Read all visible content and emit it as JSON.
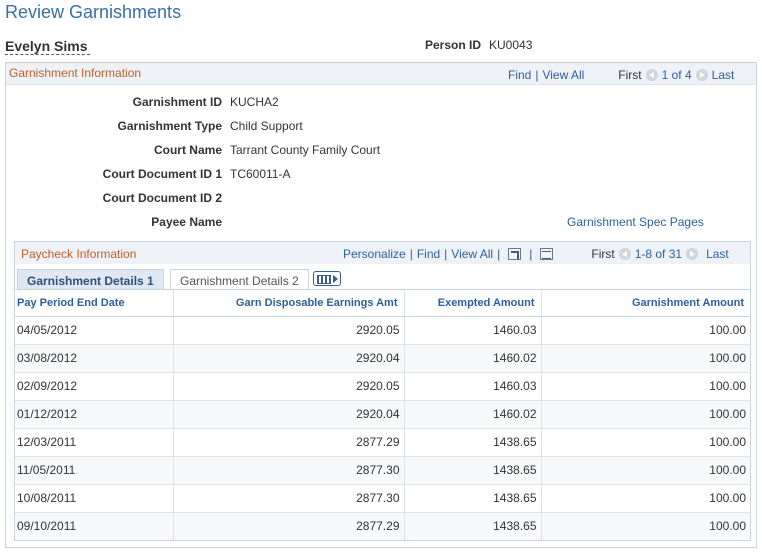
{
  "page": {
    "title": "Review Garnishments"
  },
  "person": {
    "name": "Evelyn Sims",
    "id_label": "Person ID",
    "id_value": "KU0043"
  },
  "garnishment_info": {
    "title": "Garnishment Information",
    "nav": {
      "find": "Find",
      "view_all": "View All",
      "first": "First",
      "count": "1 of 4",
      "last": "Last"
    },
    "fields": [
      {
        "label": "Garnishment ID",
        "value": "KUCHA2"
      },
      {
        "label": "Garnishment Type",
        "value": "Child Support"
      },
      {
        "label": "Court Name",
        "value": "Tarrant County Family Court"
      },
      {
        "label": "Court Document ID 1",
        "value": "TC60011-A"
      },
      {
        "label": "Court Document ID 2",
        "value": ""
      },
      {
        "label": "Payee Name",
        "value": ""
      }
    ],
    "spec_link": "Garnishment Spec Pages"
  },
  "paycheck_info": {
    "title": "Paycheck Information",
    "nav": {
      "personalize": "Personalize",
      "find": "Find",
      "view_all": "View All",
      "first": "First",
      "count": "1-8 of 31",
      "last": "Last"
    },
    "tabs": [
      {
        "label": "Garnishment Details 1",
        "active": true
      },
      {
        "label": "Garnishment Details 2",
        "active": false
      }
    ],
    "columns": [
      "Pay Period End Date",
      "Garn Disposable Earnings Amt",
      "Exempted Amount",
      "Garnishment Amount"
    ],
    "rows": [
      [
        "04/05/2012",
        "2920.05",
        "1460.03",
        "100.00"
      ],
      [
        "03/08/2012",
        "2920.04",
        "1460.02",
        "100.00"
      ],
      [
        "02/09/2012",
        "2920.05",
        "1460.03",
        "100.00"
      ],
      [
        "01/12/2012",
        "2920.04",
        "1460.02",
        "100.00"
      ],
      [
        "12/03/2011",
        "2877.29",
        "1438.65",
        "100.00"
      ],
      [
        "11/05/2011",
        "2877.30",
        "1438.65",
        "100.00"
      ],
      [
        "10/08/2011",
        "2877.30",
        "1438.65",
        "100.00"
      ],
      [
        "09/10/2011",
        "2877.29",
        "1438.65",
        "100.00"
      ]
    ]
  },
  "colors": {
    "title_blue": "#3a6ea5",
    "link_blue": "#2d5f9e",
    "section_orange": "#c0602a",
    "header_bg": "#eef2f6"
  }
}
